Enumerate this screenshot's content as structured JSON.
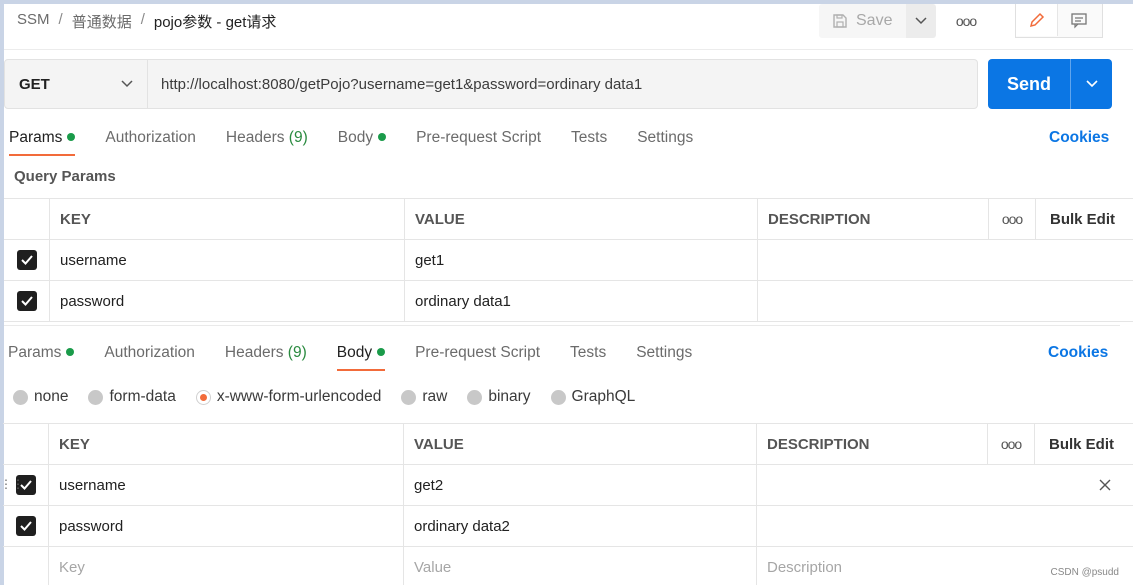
{
  "breadcrumb": [
    "SSM",
    "普通数据",
    "pojo参数 - get请求"
  ],
  "breadcrumb_sep": "/",
  "toolbar": {
    "save_label": "Save",
    "more_label": "ooo"
  },
  "request": {
    "method": "GET",
    "url": "http://localhost:8080/getPojo?username=get1&password=ordinary data1",
    "send_label": "Send"
  },
  "tabs_top": {
    "params": "Params",
    "authorization": "Authorization",
    "headers": "Headers",
    "headers_count": "(9)",
    "body": "Body",
    "prerequest": "Pre-request Script",
    "tests": "Tests",
    "settings": "Settings",
    "cookies": "Cookies"
  },
  "query_params_title": "Query Params",
  "query_table": {
    "headers": {
      "key": "KEY",
      "value": "VALUE",
      "description": "DESCRIPTION",
      "dots": "ooo",
      "bulk": "Bulk Edit"
    },
    "rows": [
      {
        "key": "username",
        "value": "get1"
      },
      {
        "key": "password",
        "value": "ordinary data1"
      }
    ]
  },
  "tabs_bottom": {
    "params": "Params",
    "authorization": "Authorization",
    "headers": "Headers",
    "headers_count": "(9)",
    "body": "Body",
    "prerequest": "Pre-request Script",
    "tests": "Tests",
    "settings": "Settings",
    "cookies": "Cookies"
  },
  "body_types": [
    "none",
    "form-data",
    "x-www-form-urlencoded",
    "raw",
    "binary",
    "GraphQL"
  ],
  "body_table": {
    "headers": {
      "key": "KEY",
      "value": "VALUE",
      "description": "DESCRIPTION",
      "dots": "ooo",
      "bulk": "Bulk Edit"
    },
    "rows": [
      {
        "key": "username",
        "value": "get2"
      },
      {
        "key": "password",
        "value": "ordinary data2"
      }
    ],
    "placeholders": {
      "key": "Key",
      "value": "Value",
      "description": "Description"
    }
  },
  "watermark": "CSDN @psudd",
  "colors": {
    "accent": "#0b76e4",
    "tab_underline": "#f26b3a",
    "dot": "#1a9b4a"
  }
}
